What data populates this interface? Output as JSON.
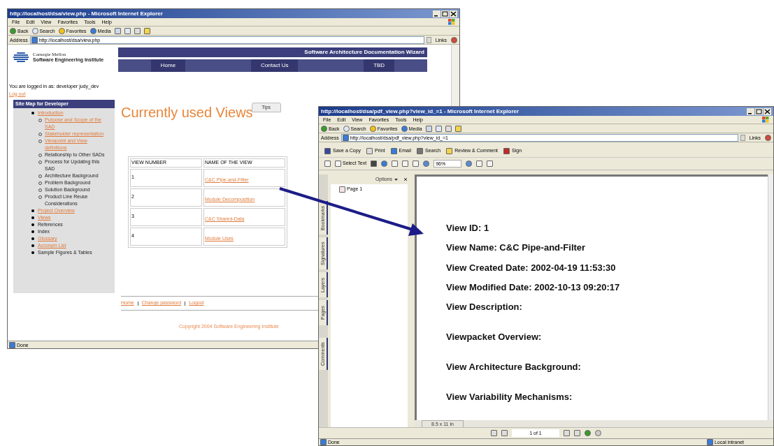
{
  "back_window": {
    "title": "http://localhost/dsa/view.php - Microsoft Internet Explorer",
    "menu": [
      "File",
      "Edit",
      "View",
      "Favorites",
      "Tools",
      "Help"
    ],
    "toolbar": [
      "Back",
      "Search",
      "Favorites",
      "Media"
    ],
    "address_label": "Address",
    "address": "http://localhost/dsa/view.php",
    "links_label": "Links",
    "logo_lines": [
      "Carnegie Mellon",
      "Software Engineering Institute"
    ],
    "banner_title": "Software Architecture Documentation Wizard",
    "nav": [
      "Home",
      "Contact Us",
      "TBD"
    ],
    "logged_in": "You are logged in as: developer judy_dev",
    "logout": "Log out",
    "sitemap": {
      "title": "Site Map for Developer",
      "items": [
        {
          "label": "Introduction",
          "link": true,
          "children": [
            {
              "label": "Purpose and Scope of the SAD",
              "link": true
            },
            {
              "label": "Stakeholder representation",
              "link": true
            },
            {
              "label": "Viewpoint and View definitions",
              "link": true
            },
            {
              "label": "Relationship to Other SADs",
              "link": false
            },
            {
              "label": "Process for Updating this SAD",
              "link": false
            },
            {
              "label": "Architecture Background",
              "link": false
            },
            {
              "label": "Problem Background",
              "link": false
            },
            {
              "label": "Solution Background",
              "link": false
            },
            {
              "label": "Product Line Reuse Considerations",
              "link": false
            }
          ]
        },
        {
          "label": "Project Overview",
          "link": true
        },
        {
          "label": "Views",
          "link": true
        },
        {
          "label": "References",
          "link": false
        },
        {
          "label": "Index",
          "link": false
        },
        {
          "label": "Glossary",
          "link": true
        },
        {
          "label": "Acronym List",
          "link": true
        },
        {
          "label": "Sample Figures & Tables",
          "link": false
        }
      ]
    },
    "heading": "Currently used Views",
    "tips_button": "Tips",
    "table": {
      "columns": [
        "VIEW NUMBER",
        "NAME OF THE VIEW"
      ],
      "rows": [
        [
          "1",
          "C&C Pipe-and-Filter"
        ],
        [
          "2",
          "Module Decomposition"
        ],
        [
          "3",
          "C&C Shared-Data"
        ],
        [
          "4",
          "Module Uses"
        ]
      ]
    },
    "footer_links": [
      "Home",
      "Change password",
      "Logout"
    ],
    "copyright": "Copyright 2004 Software Engineering Institute",
    "status": "Done"
  },
  "front_window": {
    "title": "http://localhost/dsa/pdf_view.php?view_id_=1 - Microsoft Internet Explorer",
    "menu": [
      "File",
      "Edit",
      "View",
      "Favorites",
      "Tools",
      "Help"
    ],
    "toolbar": [
      "Back",
      "Search",
      "Favorites",
      "Media"
    ],
    "address_label": "Address",
    "address": "http://localhost/dsa/pdf_view.php?view_id_=1",
    "links_label": "Links",
    "reader_toolbar": [
      "Save a Copy",
      "Print",
      "Email",
      "Search",
      "Review & Comment",
      "Sign"
    ],
    "select_text": "Select Text",
    "zoom": "96%",
    "options": "Options",
    "bookmarks": [
      "Page 1"
    ],
    "side_tabs": [
      "Bookmarks",
      "Signatures",
      "Layers",
      "Pages",
      "Comments"
    ],
    "page_lines": [
      "View ID: 1",
      "View Name: C&C Pipe-and-Filter",
      "View Created Date: 2002-04-19 11:53:30",
      "View Modified Date: 2002-10-13 09:20:17",
      "View Description:",
      "Viewpacket Overview:",
      "View Architecture Background:",
      "View Variability Mechanisms:"
    ],
    "page_size": "8.5 x 11 in",
    "page_nav": "1 of 1",
    "status": "Done",
    "zone": "Local intranet"
  }
}
